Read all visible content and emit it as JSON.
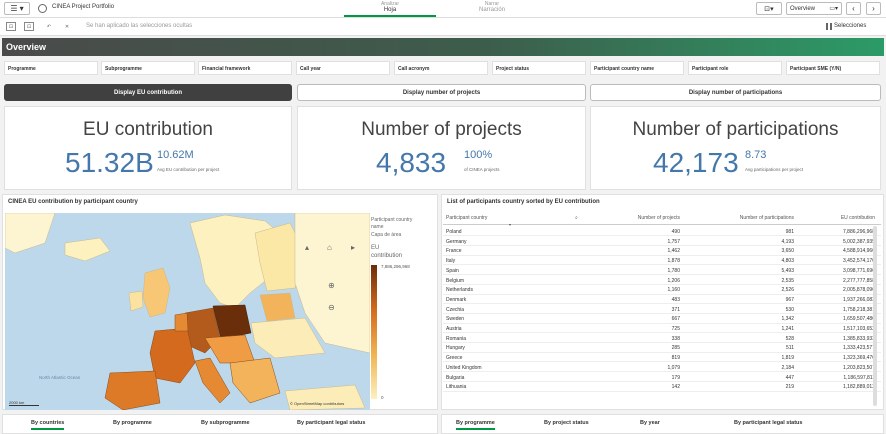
{
  "app": {
    "title": "CINEA Project Portfolio",
    "modes": [
      {
        "label": "Analizar",
        "sub": "Hoja"
      },
      {
        "label": "Narrar",
        "sub": "Narración"
      }
    ],
    "sheet_button": "Overview"
  },
  "selection_bar": {
    "message": "Se han aplicado las selecciones ocultas",
    "selections_label": "Selecciones"
  },
  "sheet": {
    "title": "Overview"
  },
  "filters": [
    "Programme",
    "Subprogramme",
    "Financial framework",
    "Call year",
    "Call acronym",
    "Project status",
    "Participant country name",
    "Participant role",
    "Participant SME (Y/N)"
  ],
  "display_buttons": [
    "Display EU contribution",
    "Display number of projects",
    "Display number of participations"
  ],
  "kpis": [
    {
      "title": "EU contribution",
      "main": "51.32B",
      "side": "10.62M",
      "sub": "Avg EU contribution per project"
    },
    {
      "title": "Number of projects",
      "main": "4,833",
      "side": "100%",
      "sub": "of CINEA projects"
    },
    {
      "title": "Number of participations",
      "main": "42,173",
      "side": "8.73",
      "sub": "Avg participations per project"
    }
  ],
  "map_panel": {
    "title": "CINEA EU contribution by participant country",
    "legend_label_1": "Participant country",
    "legend_label_2": "name",
    "legend_label_3": "Capa de área",
    "legend_label_4": "EU",
    "legend_label_5": "contribution",
    "legend_max": "7,886,296,968",
    "legend_min": "0",
    "sea_label": "North Atlantic Ocean",
    "scale": "2000 km",
    "attribution": "© OpenStreetMap contributors"
  },
  "table_panel": {
    "title": "List of participants country sorted by EU contribution",
    "headers": [
      "Participant country",
      "Number of projects",
      "Number of participations",
      "EU contribution"
    ],
    "rows": [
      [
        "Poland",
        "490",
        "981",
        "7,886,296,968"
      ],
      [
        "Germany",
        "1,757",
        "4,193",
        "5,002,387,935"
      ],
      [
        "France",
        "1,462",
        "3,650",
        "4,588,914,966"
      ],
      [
        "Italy",
        "1,878",
        "4,803",
        "3,452,574,170"
      ],
      [
        "Spain",
        "1,780",
        "5,493",
        "3,098,771,696"
      ],
      [
        "Belgium",
        "1,206",
        "2,535",
        "2,277,777,858"
      ],
      [
        "Netherlands",
        "1,160",
        "2,526",
        "2,005,878,096"
      ],
      [
        "Denmark",
        "483",
        "967",
        "1,937,266,083"
      ],
      [
        "Czechia",
        "371",
        "530",
        "1,758,218,381"
      ],
      [
        "Sweden",
        "667",
        "1,342",
        "1,659,507,486"
      ],
      [
        "Austria",
        "725",
        "1,241",
        "1,517,103,652"
      ],
      [
        "Romania",
        "338",
        "528",
        "1,385,833,933"
      ],
      [
        "Hungary",
        "285",
        "511",
        "1,333,423,577"
      ],
      [
        "Greece",
        "819",
        "1,819",
        "1,323,369,476"
      ],
      [
        "United Kingdom",
        "1,079",
        "2,184",
        "1,203,823,507"
      ],
      [
        "Bulgaria",
        "179",
        "447",
        "1,186,597,811"
      ],
      [
        "Lithuania",
        "142",
        "219",
        "1,182,889,012"
      ]
    ]
  },
  "tabs_left": [
    "By countries",
    "By programme",
    "By subprogramme",
    "By participant legal status"
  ],
  "tabs_right": [
    "By programme",
    "By project status",
    "By year",
    "By participant legal status"
  ],
  "colors": {
    "accent": "#009845",
    "kpi_blue": "#4477aa"
  }
}
